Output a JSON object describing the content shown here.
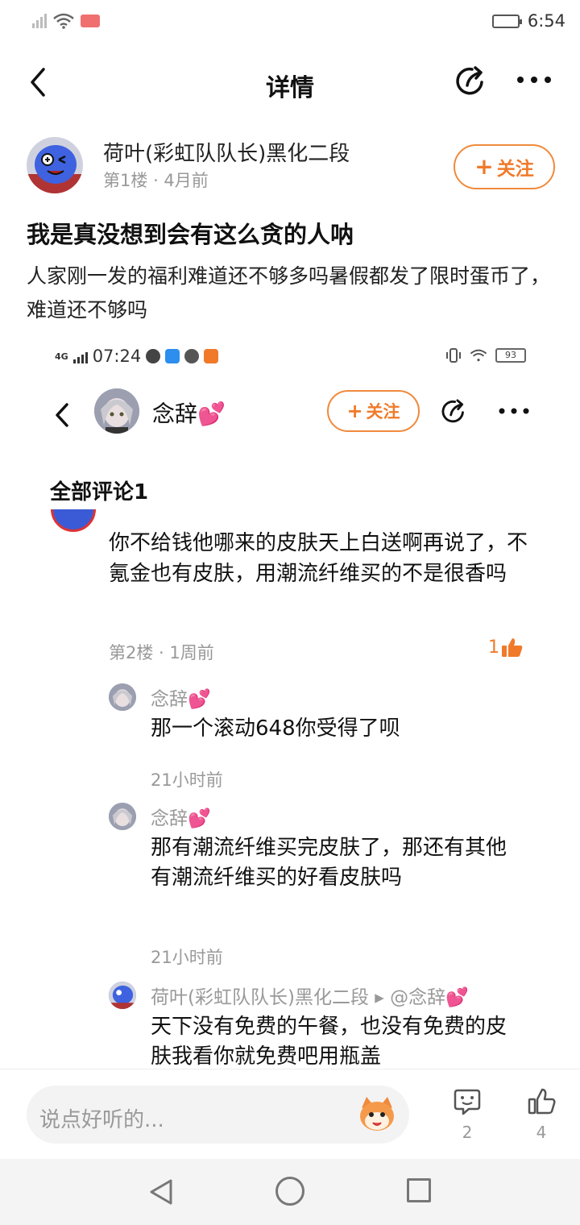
{
  "status_bar": {
    "time": "6:54"
  },
  "header": {
    "title": "详情"
  },
  "post": {
    "author_name": "荷叶(彩虹队队长)黑化二段",
    "floor": "第1楼",
    "time_ago": "4月前",
    "follow_label": "关注",
    "title": "我是真没想到会有这么贪的人呐",
    "body": "人家刚一发的福利难道还不够多吗暑假都发了限时蛋币了，难道还不够吗"
  },
  "embedded": {
    "status_time": "07:24",
    "signal_label": "4G",
    "battery": "93",
    "profile_name": "念辞💕",
    "follow_label": "关注",
    "section_title": "全部评论1",
    "comment": {
      "text": "你不给钱他哪来的皮肤天上白送啊再说了，不氪金也有皮肤，用潮流纤维买的不是很香吗",
      "meta": "第2楼 · 1周前",
      "likes": "1"
    },
    "replies": [
      {
        "name": "念辞💕",
        "text": "那一个滚动648你受得了呗",
        "time": "21小时前"
      },
      {
        "name": "念辞💕",
        "text": "那有潮流纤维买完皮肤了，那还有其他有潮流纤维买的好看皮肤吗",
        "time": "21小时前"
      },
      {
        "name": "荷叶(彩虹队队长)黑化二段 ▸ @念辞💕",
        "text": "天下没有免费的午餐，也没有免费的皮肤我看你就免费吧用瓶盖"
      }
    ]
  },
  "bottom_bar": {
    "input_placeholder": "说点好听的...",
    "comment_count": "2",
    "like_count": "4"
  },
  "colors": {
    "accent": "#f07a2a",
    "muted": "#999999"
  }
}
